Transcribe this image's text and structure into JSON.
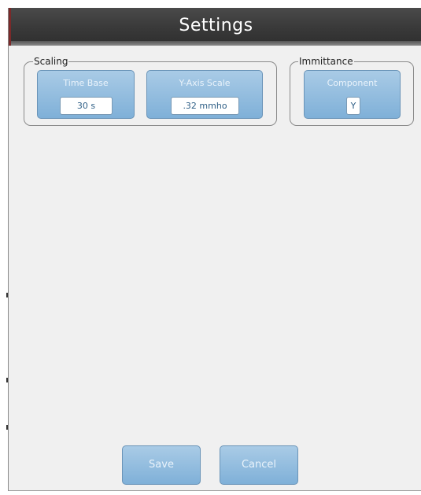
{
  "window": {
    "title": "Settings"
  },
  "scaling": {
    "label": "Scaling",
    "time_base": {
      "title": "Time Base",
      "value": "30 s"
    },
    "y_axis_scale": {
      "title": "Y-Axis Scale",
      "value": ".32 mmho"
    }
  },
  "immittance": {
    "label": "Immittance",
    "component": {
      "title": "Component",
      "value": "Y"
    }
  },
  "footer": {
    "save_label": "Save",
    "cancel_label": "Cancel"
  },
  "colors": {
    "titlebar": "#3a3a3a",
    "tile": "#8fbbe0",
    "panel": "#f0f0f0"
  }
}
